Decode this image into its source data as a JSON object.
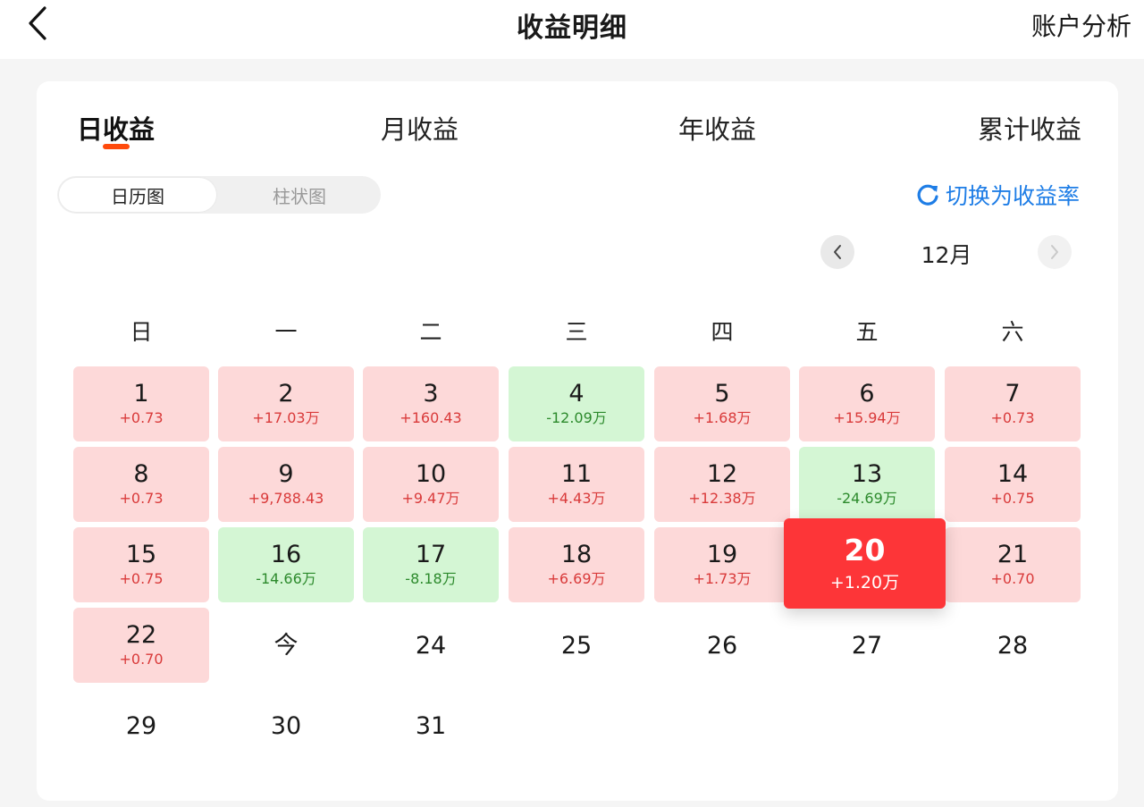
{
  "header": {
    "title": "收益明细",
    "right_link": "账户分析"
  },
  "tabs": [
    {
      "label": "日收益",
      "active": true
    },
    {
      "label": "月收益",
      "active": false
    },
    {
      "label": "年收益",
      "active": false
    },
    {
      "label": "累计收益",
      "active": false
    }
  ],
  "view_toggle": {
    "calendar": "日历图",
    "bar": "柱状图",
    "selected": "日历图"
  },
  "switch_label": "切换为收益率",
  "month": "12月",
  "weekdays": [
    "日",
    "一",
    "二",
    "三",
    "四",
    "五",
    "六"
  ],
  "calendar": [
    {
      "day": "1",
      "value": "+0.73",
      "trend": "up"
    },
    {
      "day": "2",
      "value": "+17.03万",
      "trend": "up"
    },
    {
      "day": "3",
      "value": "+160.43",
      "trend": "up"
    },
    {
      "day": "4",
      "value": "-12.09万",
      "trend": "down"
    },
    {
      "day": "5",
      "value": "+1.68万",
      "trend": "up"
    },
    {
      "day": "6",
      "value": "+15.94万",
      "trend": "up"
    },
    {
      "day": "7",
      "value": "+0.73",
      "trend": "up"
    },
    {
      "day": "8",
      "value": "+0.73",
      "trend": "up"
    },
    {
      "day": "9",
      "value": "+9,788.43",
      "trend": "up"
    },
    {
      "day": "10",
      "value": "+9.47万",
      "trend": "up"
    },
    {
      "day": "11",
      "value": "+4.43万",
      "trend": "up"
    },
    {
      "day": "12",
      "value": "+12.38万",
      "trend": "up"
    },
    {
      "day": "13",
      "value": "-24.69万",
      "trend": "down"
    },
    {
      "day": "14",
      "value": "+0.75",
      "trend": "up"
    },
    {
      "day": "15",
      "value": "+0.75",
      "trend": "up"
    },
    {
      "day": "16",
      "value": "-14.66万",
      "trend": "down"
    },
    {
      "day": "17",
      "value": "-8.18万",
      "trend": "down"
    },
    {
      "day": "18",
      "value": "+6.69万",
      "trend": "up"
    },
    {
      "day": "19",
      "value": "+1.73万",
      "trend": "up"
    },
    {
      "day": "20",
      "value": "+1.20万",
      "trend": "up",
      "selected": true
    },
    {
      "day": "21",
      "value": "+0.70",
      "trend": "up"
    },
    {
      "day": "22",
      "value": "+0.70",
      "trend": "up"
    },
    {
      "day": "今",
      "value": "",
      "trend": "none"
    },
    {
      "day": "24",
      "value": "",
      "trend": "none"
    },
    {
      "day": "25",
      "value": "",
      "trend": "none"
    },
    {
      "day": "26",
      "value": "",
      "trend": "none"
    },
    {
      "day": "27",
      "value": "",
      "trend": "none"
    },
    {
      "day": "28",
      "value": "",
      "trend": "none"
    },
    {
      "day": "29",
      "value": "",
      "trend": "none"
    },
    {
      "day": "30",
      "value": "",
      "trend": "none"
    },
    {
      "day": "31",
      "value": "",
      "trend": "none"
    }
  ],
  "colors": {
    "up_bg": "#fdd9d9",
    "up_text": "#d93a3a",
    "down_bg": "#d4f6d4",
    "down_text": "#2c8a2c",
    "selected_bg": "#fd3538",
    "accent_underline": "#ff4a0c",
    "link_blue": "#1e7de6"
  }
}
